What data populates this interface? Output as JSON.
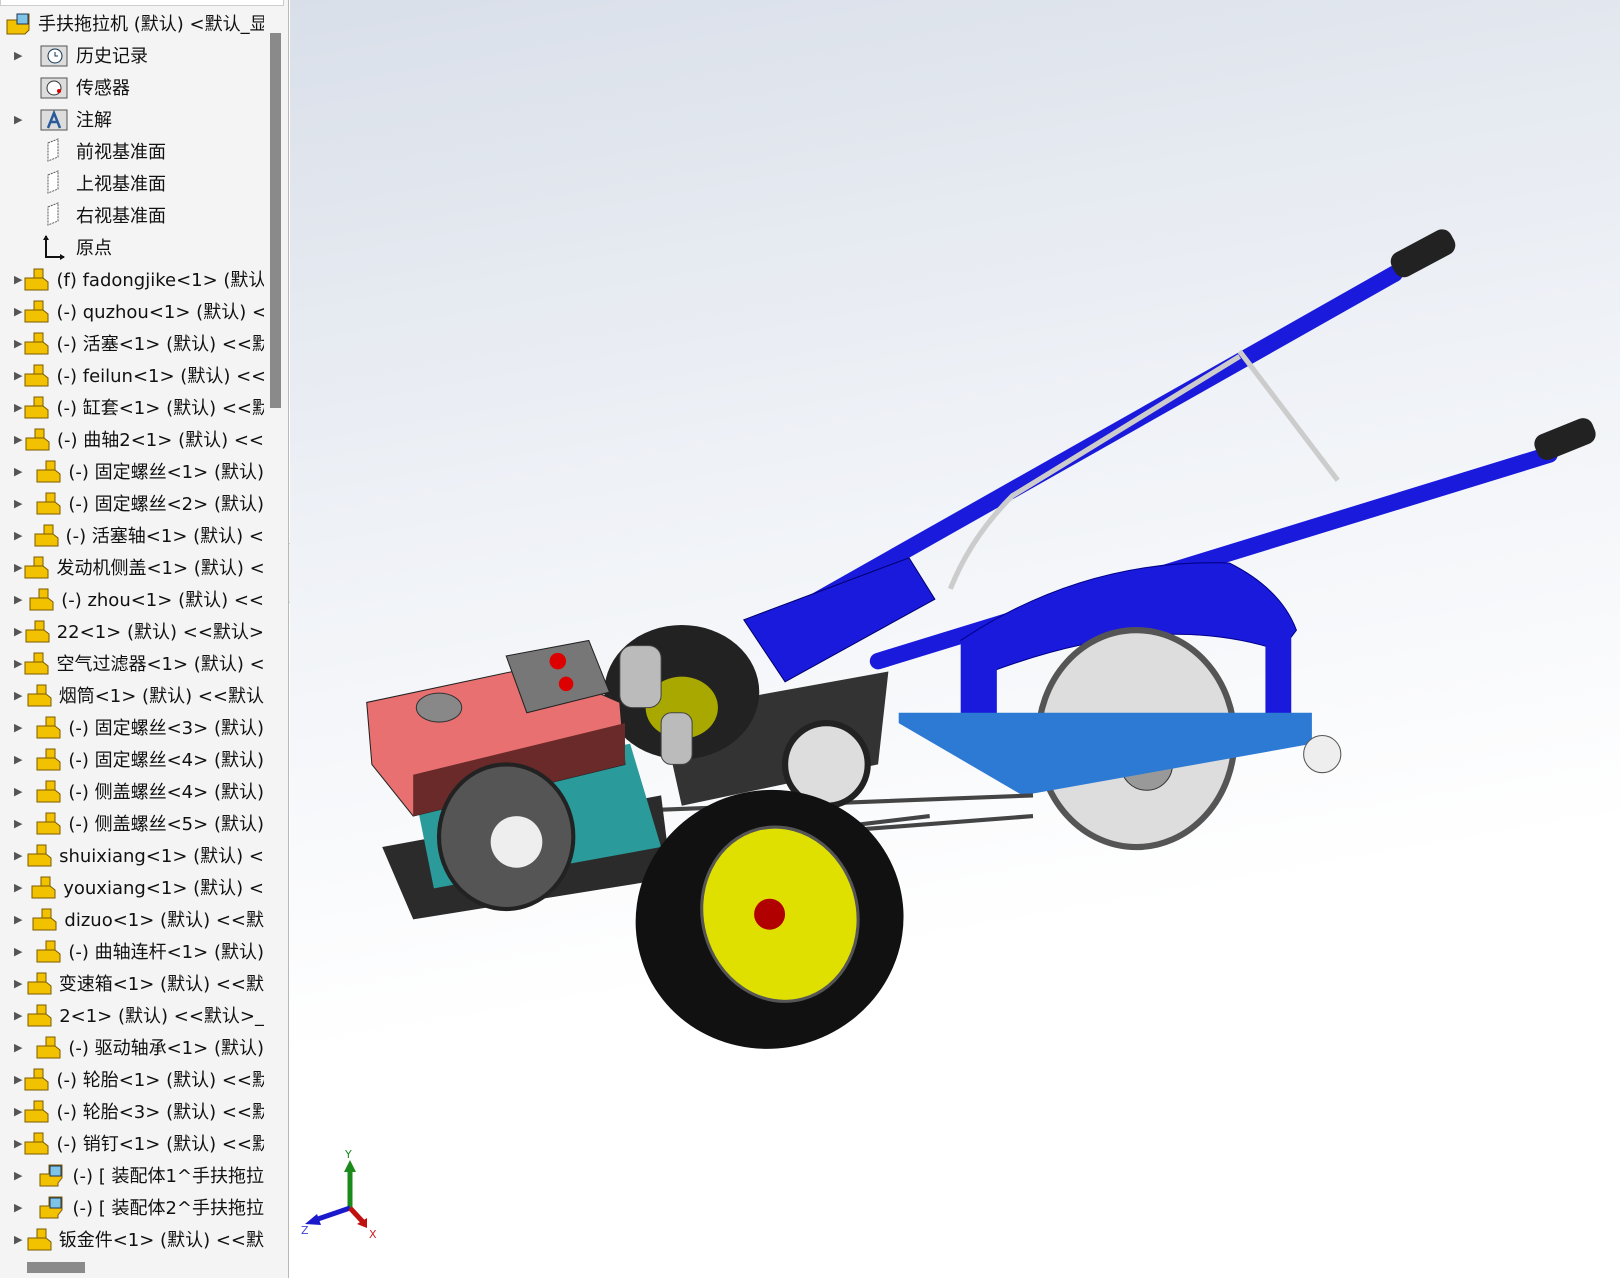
{
  "tree": {
    "root": "手扶拖拉机 (默认) <默认_显",
    "items": [
      {
        "label": "历史记录",
        "icon": "history-folder-icon",
        "expand": true
      },
      {
        "label": "传感器",
        "icon": "sensor-folder-icon",
        "expand": false
      },
      {
        "label": "注解",
        "icon": "annotation-folder-icon",
        "expand": true
      },
      {
        "label": "前视基准面",
        "icon": "plane-icon",
        "expand": false
      },
      {
        "label": "上视基准面",
        "icon": "plane-icon",
        "expand": false
      },
      {
        "label": "右视基准面",
        "icon": "plane-icon",
        "expand": false
      },
      {
        "label": "原点",
        "icon": "origin-icon",
        "expand": false
      },
      {
        "label": "(f) fadongjike<1> (默认",
        "icon": "part-icon",
        "expand": true
      },
      {
        "label": "(-) quzhou<1> (默认) <",
        "icon": "part-icon",
        "expand": true
      },
      {
        "label": "(-) 活塞<1> (默认) <<默",
        "icon": "part-icon",
        "expand": true
      },
      {
        "label": "(-) feilun<1> (默认) <<",
        "icon": "part-icon",
        "expand": true
      },
      {
        "label": "(-) 缸套<1> (默认) <<默",
        "icon": "part-icon",
        "expand": true
      },
      {
        "label": "(-) 曲轴2<1> (默认) <<",
        "icon": "part-icon",
        "expand": true
      },
      {
        "label": "(-) 固定螺丝<1> (默认)",
        "icon": "part-icon",
        "expand": true
      },
      {
        "label": "(-) 固定螺丝<2> (默认)",
        "icon": "part-icon",
        "expand": true
      },
      {
        "label": "(-) 活塞轴<1> (默认) <",
        "icon": "part-icon",
        "expand": true
      },
      {
        "label": "发动机侧盖<1> (默认) <",
        "icon": "part-icon",
        "expand": true
      },
      {
        "label": "(-) zhou<1> (默认) <<",
        "icon": "part-icon",
        "expand": true
      },
      {
        "label": "22<1> (默认) <<默认>",
        "icon": "part-icon",
        "expand": true
      },
      {
        "label": "空气过滤器<1> (默认) <",
        "icon": "part-icon",
        "expand": true
      },
      {
        "label": "烟筒<1> (默认) <<默认",
        "icon": "part-icon",
        "expand": true
      },
      {
        "label": "(-) 固定螺丝<3> (默认)",
        "icon": "part-icon",
        "expand": true
      },
      {
        "label": "(-) 固定螺丝<4> (默认)",
        "icon": "part-icon",
        "expand": true
      },
      {
        "label": "(-) 侧盖螺丝<4> (默认)",
        "icon": "part-icon",
        "expand": true
      },
      {
        "label": "(-) 侧盖螺丝<5> (默认)",
        "icon": "part-icon",
        "expand": true
      },
      {
        "label": "shuixiang<1> (默认) <",
        "icon": "part-icon",
        "expand": true
      },
      {
        "label": "youxiang<1> (默认) <",
        "icon": "part-icon",
        "expand": true
      },
      {
        "label": "dizuo<1> (默认) <<默",
        "icon": "part-icon",
        "expand": true
      },
      {
        "label": "(-) 曲轴连杆<1> (默认)",
        "icon": "part-icon",
        "expand": true
      },
      {
        "label": "变速箱<1> (默认) <<默",
        "icon": "part-icon",
        "expand": true
      },
      {
        "label": "2<1> (默认) <<默认>_",
        "icon": "part-icon",
        "expand": true
      },
      {
        "label": "(-) 驱动轴承<1> (默认)",
        "icon": "part-icon",
        "expand": true
      },
      {
        "label": "(-) 轮胎<1> (默认) <<默",
        "icon": "part-icon",
        "expand": true
      },
      {
        "label": "(-) 轮胎<3> (默认) <<默",
        "icon": "part-icon",
        "expand": true
      },
      {
        "label": "(-) 销钉<1> (默认) <<默",
        "icon": "part-icon",
        "expand": true
      },
      {
        "label": "(-) [ 装配体1^手扶拖拉",
        "icon": "assembly-icon",
        "expand": true
      },
      {
        "label": "(-) [ 装配体2^手扶拖拉",
        "icon": "assembly-icon",
        "expand": true
      },
      {
        "label": "钣金件<1> (默认) <<默",
        "icon": "part-icon",
        "expand": true
      }
    ]
  },
  "triad": {
    "x": "X",
    "y": "Y",
    "z": "Z"
  },
  "colors": {
    "body": "#1a1adc",
    "tank": "#e87070",
    "rim": "#e0e000"
  }
}
